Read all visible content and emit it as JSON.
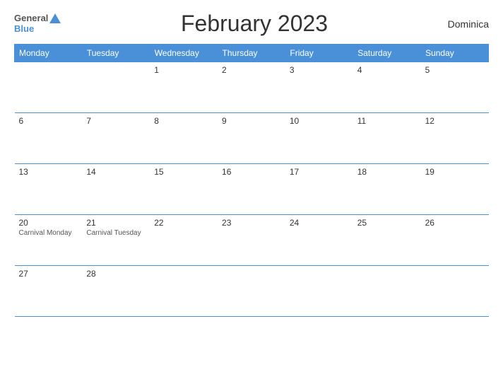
{
  "header": {
    "title": "February 2023",
    "country": "Dominica",
    "logo_general": "General",
    "logo_blue": "Blue"
  },
  "calendar": {
    "days_of_week": [
      "Monday",
      "Tuesday",
      "Wednesday",
      "Thursday",
      "Friday",
      "Saturday",
      "Sunday"
    ],
    "weeks": [
      [
        {
          "day": "",
          "empty": true
        },
        {
          "day": "",
          "empty": true
        },
        {
          "day": "1",
          "empty": false
        },
        {
          "day": "2",
          "empty": false
        },
        {
          "day": "3",
          "empty": false
        },
        {
          "day": "4",
          "empty": false
        },
        {
          "day": "5",
          "empty": false
        }
      ],
      [
        {
          "day": "6",
          "empty": false
        },
        {
          "day": "7",
          "empty": false
        },
        {
          "day": "8",
          "empty": false
        },
        {
          "day": "9",
          "empty": false
        },
        {
          "day": "10",
          "empty": false
        },
        {
          "day": "11",
          "empty": false
        },
        {
          "day": "12",
          "empty": false
        }
      ],
      [
        {
          "day": "13",
          "empty": false
        },
        {
          "day": "14",
          "empty": false
        },
        {
          "day": "15",
          "empty": false
        },
        {
          "day": "16",
          "empty": false
        },
        {
          "day": "17",
          "empty": false
        },
        {
          "day": "18",
          "empty": false
        },
        {
          "day": "19",
          "empty": false
        }
      ],
      [
        {
          "day": "20",
          "empty": false,
          "holiday": "Carnival Monday"
        },
        {
          "day": "21",
          "empty": false,
          "holiday": "Carnival Tuesday"
        },
        {
          "day": "22",
          "empty": false
        },
        {
          "day": "23",
          "empty": false
        },
        {
          "day": "24",
          "empty": false
        },
        {
          "day": "25",
          "empty": false
        },
        {
          "day": "26",
          "empty": false
        }
      ],
      [
        {
          "day": "27",
          "empty": false
        },
        {
          "day": "28",
          "empty": false
        },
        {
          "day": "",
          "empty": true
        },
        {
          "day": "",
          "empty": true
        },
        {
          "day": "",
          "empty": true
        },
        {
          "day": "",
          "empty": true
        },
        {
          "day": "",
          "empty": true
        }
      ]
    ]
  }
}
